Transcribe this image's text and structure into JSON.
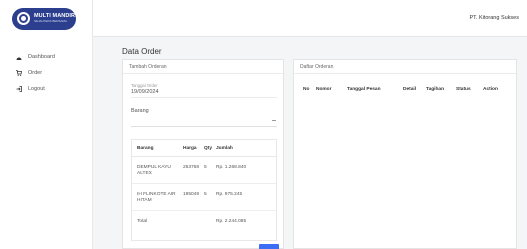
{
  "brand": {
    "name": "MULTI MANDIRI",
    "tagline": "SEJAHTERA BERSAMA"
  },
  "sidebar": {
    "items": [
      {
        "label": "Dashboard",
        "icon": "dashboard-icon"
      },
      {
        "label": "Order",
        "icon": "cart-icon"
      },
      {
        "label": "Logout",
        "icon": "logout-icon"
      }
    ]
  },
  "topbar": {
    "company": "PT. Kitorang Sukses"
  },
  "page": {
    "title": "Data Order"
  },
  "tambah": {
    "header": "Tambah Orderan",
    "date_label": "Tanggal Order",
    "date_value": "19/09/2024",
    "barang_label": "Barang",
    "table": {
      "headers": [
        "Barang",
        "Harga",
        "Qty",
        "Jumlah"
      ],
      "rows": [
        {
          "barang": "DEMPUL KAYU ALTEX",
          "harga": "253768",
          "qty": "5",
          "jumlah": "Rp. 1.268.840"
        },
        {
          "barang": "IH FLINKOTE AIR HITAM",
          "harga": "195049",
          "qty": "5",
          "jumlah": "Rp. 975.245"
        }
      ],
      "total_label": "Total",
      "total_value": "Rp. 2.244.085"
    },
    "accent": "#3b6ef5"
  },
  "daftar": {
    "header": "Daftar Orderan",
    "columns": [
      "No",
      "Nomor",
      "Tanggal Pesan",
      "Detail",
      "Tagihan",
      "Status",
      "Action"
    ]
  }
}
